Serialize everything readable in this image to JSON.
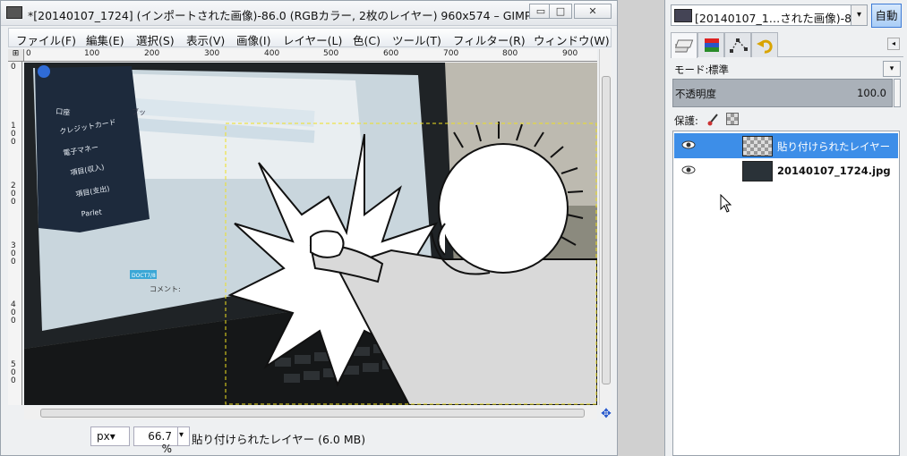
{
  "window": {
    "title": "*[20140107_1724] (インポートされた画像)-86.0 (RGBカラー, 2枚のレイヤー) 960x574 – GIMP",
    "btn_minimize": "▭",
    "btn_maximize": "□",
    "btn_close": "✕"
  },
  "menubar": {
    "items": [
      "ファイル(F)",
      "編集(E)",
      "選択(S)",
      "表示(V)",
      "画像(I)",
      "レイヤー(L)",
      "色(C)",
      "ツール(T)",
      "フィルター(R)",
      "ウィンドウ(W)"
    ]
  },
  "ruler": {
    "corner": "⊞",
    "top": [
      "0",
      "100",
      "200",
      "300",
      "400",
      "500",
      "600",
      "700",
      "800",
      "900"
    ],
    "left": [
      "0",
      "1\n0\n0",
      "2\n0\n0",
      "3\n0\n0",
      "4\n0\n0",
      "5\n0\n0"
    ]
  },
  "canvas": {
    "menu_items": [
      "口座",
      "クレジットカード",
      "電子マネー",
      "項目(収入)",
      "項目(支出)",
      "Parlet"
    ],
    "screen_text": [
      "ブッ",
      "コメント:",
      "DOCT7/8"
    ]
  },
  "statusbar": {
    "unit": "px▾",
    "zoom": "66.7 %",
    "zoom_arrow": "▾",
    "text": "貼り付けられたレイヤー (6.0 MB)"
  },
  "panel": {
    "image_label": "[20140107_1…された画像)-86",
    "image_arrow": "▾",
    "auto_button": "自動",
    "tab_menu": "◂",
    "mode_label": "モード:",
    "mode_value": "標準",
    "mode_arrow": "▾",
    "opacity_label": "不透明度",
    "opacity_value": "100.0",
    "lock_label": "保護:",
    "layers": [
      {
        "name": "貼り付けられたレイヤー",
        "selected": true
      },
      {
        "name": "20140107_1724.jpg",
        "selected": false
      }
    ]
  },
  "colors": {
    "selected_layer": "#3d8ee8",
    "selection_marquee": "#f0e020"
  }
}
